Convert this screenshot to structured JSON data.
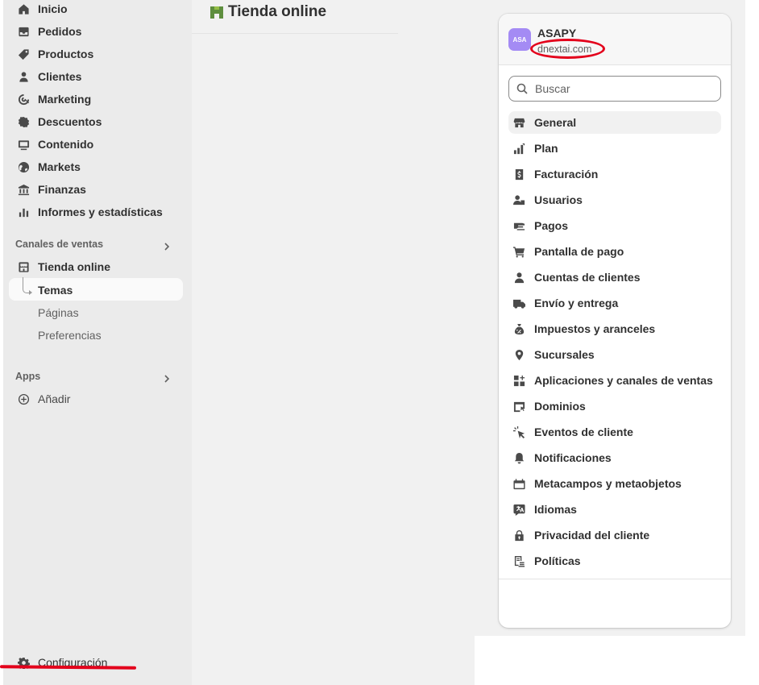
{
  "sidebar": {
    "nav": [
      {
        "label": "Inicio",
        "icon": "home-icon"
      },
      {
        "label": "Pedidos",
        "icon": "inbox-icon"
      },
      {
        "label": "Productos",
        "icon": "tag-icon"
      },
      {
        "label": "Clientes",
        "icon": "person-icon"
      },
      {
        "label": "Marketing",
        "icon": "target-icon"
      },
      {
        "label": "Descuentos",
        "icon": "discount-icon"
      },
      {
        "label": "Contenido",
        "icon": "image-icon"
      },
      {
        "label": "Markets",
        "icon": "globe-icon"
      },
      {
        "label": "Finanzas",
        "icon": "bank-icon"
      },
      {
        "label": "Informes y estadísticas",
        "icon": "bar-chart-icon"
      }
    ],
    "sales_channels": {
      "label": "Canales de ventas",
      "online_store": "Tienda online",
      "sub_items": [
        "Temas",
        "Páginas",
        "Preferencias"
      ]
    },
    "apps": {
      "label": "Apps",
      "add": "Añadir"
    },
    "settings": "Configuración"
  },
  "main": {
    "title": "Tienda online"
  },
  "settings_panel": {
    "store_initials": "ASA",
    "store_name": "ASAPY",
    "store_domain": "dnextai.com",
    "search_placeholder": "Buscar",
    "items": [
      {
        "label": "General",
        "icon": "store-icon",
        "active": true
      },
      {
        "label": "Plan",
        "icon": "plan-icon"
      },
      {
        "label": "Facturación",
        "icon": "billing-icon"
      },
      {
        "label": "Usuarios",
        "icon": "users-icon"
      },
      {
        "label": "Pagos",
        "icon": "payments-icon"
      },
      {
        "label": "Pantalla de pago",
        "icon": "cart-icon"
      },
      {
        "label": "Cuentas de clientes",
        "icon": "person-icon"
      },
      {
        "label": "Envío y entrega",
        "icon": "truck-icon"
      },
      {
        "label": "Impuestos y aranceles",
        "icon": "tax-bag-icon"
      },
      {
        "label": "Sucursales",
        "icon": "location-pin-icon"
      },
      {
        "label": "Aplicaciones y canales de ventas",
        "icon": "apps-icon"
      },
      {
        "label": "Dominios",
        "icon": "domain-icon"
      },
      {
        "label": "Eventos de cliente",
        "icon": "cursor-click-icon"
      },
      {
        "label": "Notificaciones",
        "icon": "bell-icon"
      },
      {
        "label": "Metacampos y metaobjetos",
        "icon": "metafields-icon"
      },
      {
        "label": "Idiomas",
        "icon": "language-icon"
      },
      {
        "label": "Privacidad del cliente",
        "icon": "lock-icon"
      },
      {
        "label": "Políticas",
        "icon": "policy-icon"
      }
    ]
  },
  "annotation_color": "#e3001b"
}
